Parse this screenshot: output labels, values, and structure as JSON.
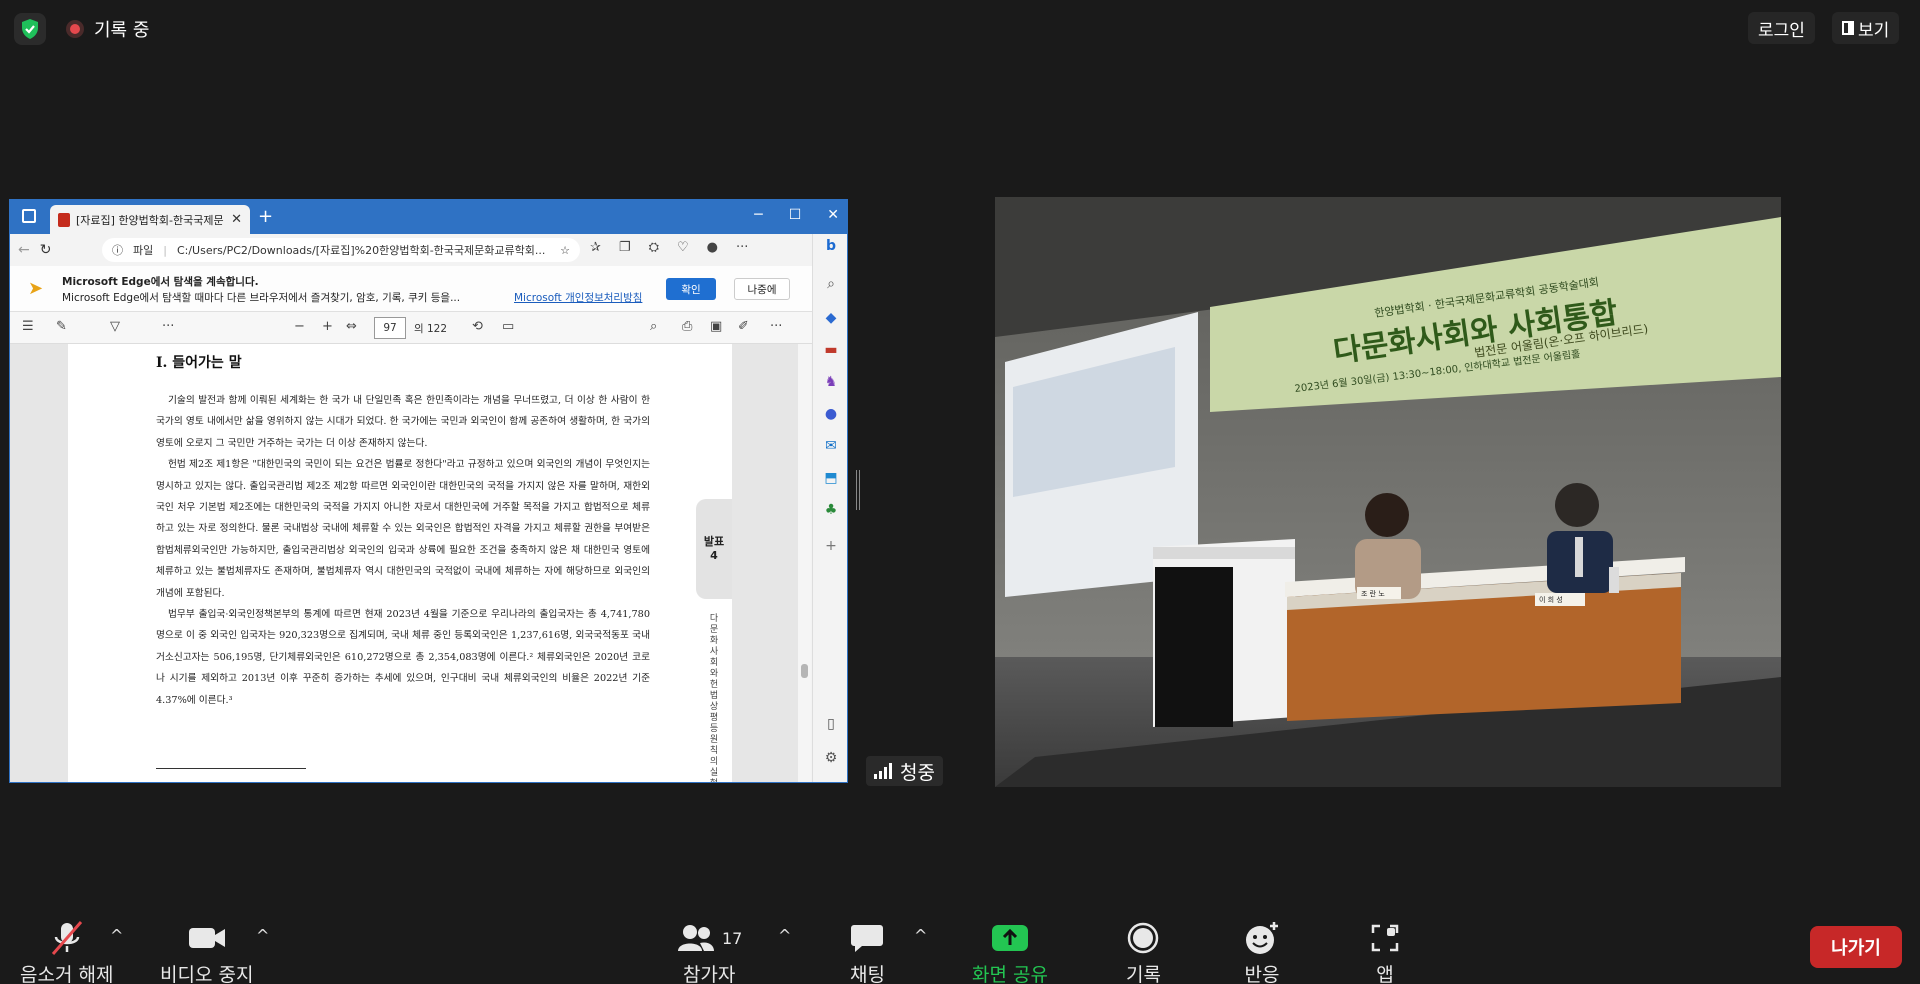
{
  "top": {
    "recording_label": "기록 중",
    "login_label": "로그인",
    "view_label": "보기"
  },
  "browser": {
    "tab_title": "[자료집] 한양법학회-한국국제문",
    "address": "C:/Users/PC2/Downloads/[자료집]%20한양법학회-한국국제문화교류학회...",
    "address_prefix": "파일",
    "notice": {
      "title": "Microsoft Edge에서 탐색을 계속합니다.",
      "text": "Microsoft Edge에서 탐색할 때마다 다른 브라우저에서 즐겨찾기, 암호, 기록, 쿠키 등을...",
      "link": "Microsoft 개인정보처리방침",
      "confirm": "확인",
      "later": "나중에"
    },
    "pdf": {
      "page_current": "97",
      "page_total": "의 122",
      "heading": "Ⅰ. 들어가는 말",
      "paragraphs": [
        "기술의 발전과 함께 이뤄된 세계화는 한 국가 내 단일민족 혹은 한민족이라는 개념을 무너뜨렸고, 더 이상 한 사람이 한 국가의 영토 내에서만 삶을 영위하지 않는 시대가 되었다. 한 국가에는 국민과 외국인이 함께 공존하여 생활하며, 한 국가의 영토에 오로지 그 국민만 거주하는 국가는 더 이상 존재하지 않는다.",
        "헌법 제2조 제1항은 \"대한민국의 국민이 되는 요건은 법률로 정한다\"라고 규정하고 있으며 외국인의 개념이 무엇인지는 명시하고 있지는 않다. 출입국관리법 제2조 제2항 따르면 외국인이란 대한민국의 국적을 가지지 않은 자를 말하며, 재한외국인 처우 기본법 제2조에는 대한민국의 국적을 가지지 아니한 자로서 대한민국에 거주할 목적을 가지고 합법적으로 체류하고 있는 자로 정의한다. 물론 국내법상 국내에 체류할 수 있는 외국인은 합법적인 자격을 가지고 체류할 권한을 부여받은 합법체류외국인만 가능하지만, 출입국관리법상 외국인의 입국과 상륙에 필요한 조건을 충족하지 않은 채 대한민국 영토에 체류하고 있는 불법체류자도 존재하며, 불법체류자 역시 대한민국의 국적없이 국내에 체류하는 자에 해당하므로 외국인의 개념에 포함된다.",
        "법무부 출입국·외국인정책본부의 통계에 따르면 현재 2023년 4월을 기준으로 우리나라의 출입국자는 총 4,741,780명으로 이 중 외국인 입국자는 920,323명으로 집계되며, 국내 체류 중인 등록외국인은 1,237,616명, 외국국적동포 국내거소신고자는 506,195명, 단기체류외국인은 610,272명으로 총 2,354,083명에 이른다.² 체류외국인은 2020년 코로나 시기를 제외하고 2013년 이후 꾸준히 증가하는 추세에 있으며, 인구대비 국내 체류외국인의 비율은 2022년 기준 4.37%에 이른다.³"
      ],
      "side_tab": [
        "발표",
        "4"
      ],
      "side_text": "다문화 사회와 헌법상 평등원칙의 실현"
    }
  },
  "speaker": {
    "label": "청중"
  },
  "video": {
    "banner_org": "한양법학회 · 한국국제문화교류학회 공동학술대회",
    "banner_title": "다문화사회와 사회통합",
    "banner_sub": "법전문 어울림(온·오프 하이브리드)",
    "banner_date": "2023년 6월 30일(금) 13:30~18:00, 인하대학교 법전문 어울림홀",
    "nameplate_left": "조 란 노",
    "nameplate_right": "이 희 성"
  },
  "toolbar": {
    "unmute": "음소거 해제",
    "video": "비디오 중지",
    "participants": "참가자",
    "participant_count": "17",
    "chat": "채팅",
    "share": "화면 공유",
    "record": "기록",
    "reactions": "반응",
    "apps": "앱",
    "leave": "나가기"
  },
  "colors": {
    "share_green": "#23c552",
    "leave_red": "#c72828",
    "edge_blue": "#2f72c4",
    "shield_green": "#1fbf5a"
  }
}
